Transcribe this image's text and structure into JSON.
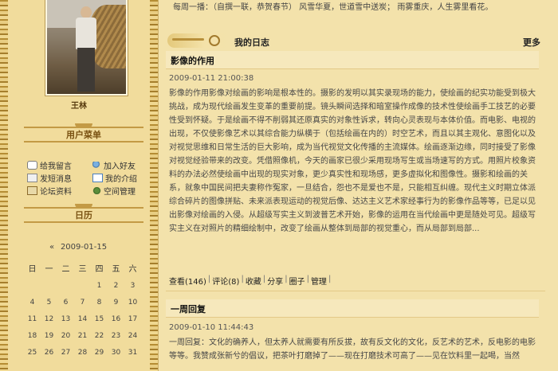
{
  "user": {
    "name": "王林"
  },
  "sidebar": {
    "menu_title": "用户菜单",
    "menu_items": [
      {
        "label": "给我留言",
        "icon": "message-icon"
      },
      {
        "label": "加入好友",
        "icon": "friend-icon"
      },
      {
        "label": "发短消息",
        "icon": "send-message-icon"
      },
      {
        "label": "我的介绍",
        "icon": "profile-icon"
      },
      {
        "label": "论坛资料",
        "icon": "forum-icon"
      },
      {
        "label": "空间管理",
        "icon": "space-manage-icon"
      }
    ],
    "calendar_title": "日历",
    "calendar": {
      "prev": "«",
      "current": "2009-01-15",
      "weekdays": [
        "日",
        "一",
        "二",
        "三",
        "四",
        "五",
        "六"
      ],
      "days": [
        "",
        "",
        "",
        "",
        "1",
        "2",
        "3",
        "4",
        "5",
        "6",
        "7",
        "8",
        "9",
        "10",
        "11",
        "12",
        "13",
        "14",
        "15",
        "16",
        "17",
        "18",
        "19",
        "20",
        "21",
        "22",
        "23",
        "24",
        "25",
        "26",
        "27",
        "28",
        "29",
        "30",
        "31"
      ]
    }
  },
  "top_line": "每周一播：（自撰一联，恭贺春节）  风雪华夏，世道雪中送炭；  雨雾重庆，人生雾里看花。",
  "blog": {
    "section_title": "我的日志",
    "more_label": "更多",
    "posts": [
      {
        "title": "影像的作用",
        "date": "2009-01-11 21:00:38",
        "body": "影像的作用影像对绘画的影响是根本性的。摄影的发明以其实录现场的能力，使绘画的纪实功能受到极大挑战，成为现代绘画发生变革的重要前提。镜头瞬间选择和暗室操作成像的技术性使绘画手工技艺的必要性受到怀疑。于是绘画不得不削弱其还原真实的对象性诉求，转向心灵表现与本体价值。而电影、电视的出现，不仅使影像艺术以其综合能力纵横于（包括绘画在内的）时空艺术，而且以其主观化、意图化以及对视觉思维和日常生活的巨大影响，成为当代视觉文化传播的主流媒体。绘画逐渐边缘，同时接受了影像对视觉经验带来的改变。凭借照像机，今天的画家已很少采用现场写生或当场速写的方式。用照片校象资料的办法必然使绘画中出现的现实对象，更少真实性和现场感，更多虚拟化和图像性。摄影和绘画的关系，就象中国民间把夫妻称作冤家，一旦结合，怨也不是爱也不是，只能相互纠缠。现代主义时期立体派综合碎片的图像拼贴、未来派表现运动的视觉后像、达达主义艺术家经事行为的影像作品等等，已足以见出影像对绘画的入侵。从超级写实主义到波普艺术开始，影像的运用在当代绘画中更是随处可见。超级写实主义在对照片的精细绘制中，改变了绘画从整体到局部的视觉重心，而从局部到局部...",
        "actions": [
          "查看(146)",
          "评论(8)",
          "收藏",
          "分享",
          "圈子",
          "管理"
        ]
      },
      {
        "title": "一周回复",
        "date": "2009-01-10 11:44:43",
        "body": "一周回复：文化的确养人，但太养人就需要有所反拔，故有反文化的文化，反艺术的艺术，反电影的电影等等。我赞成张新兮的倡议，把茶叶打磨掉了——现在打磨技术可高了——见在饮料里一起喝，当然"
      }
    ]
  },
  "colors": {
    "background": "#f3e2ab",
    "accent": "#c39a45"
  }
}
